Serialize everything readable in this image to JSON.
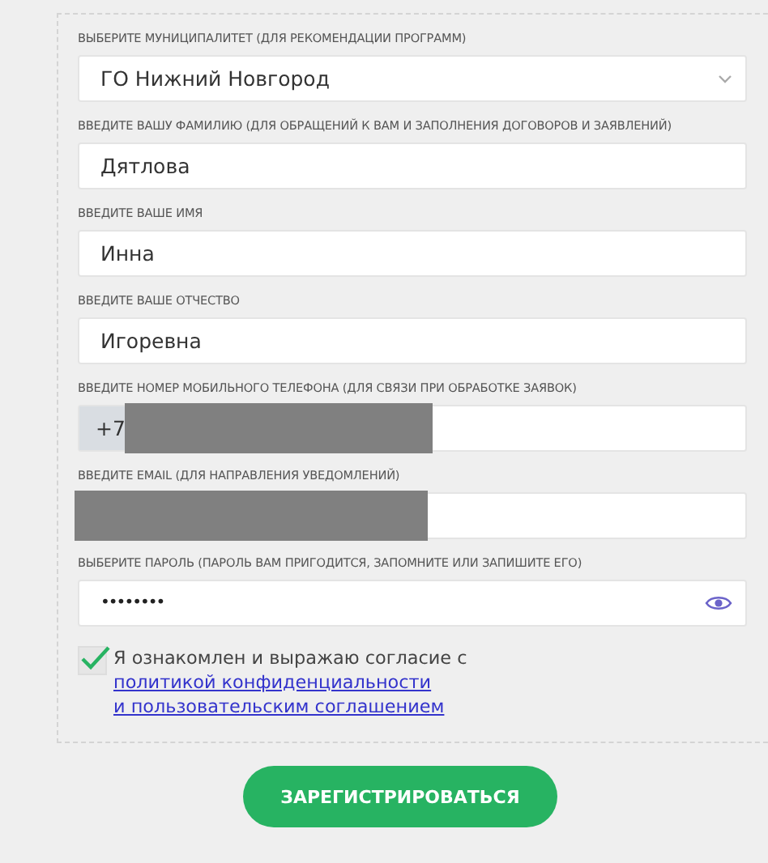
{
  "fields": [
    {
      "kind": "select",
      "label": "ВЫБЕРИТЕ МУНИЦИПАЛИТЕТ (ДЛЯ РЕКОМЕНДАЦИИ ПРОГРАММ)",
      "value": "ГО Нижний Новгород"
    },
    {
      "kind": "text",
      "label": "ВВЕДИТЕ ВАШУ ФАМИЛИЮ (ДЛЯ ОБРАЩЕНИЙ К ВАМ И ЗАПОЛНЕНИЯ ДОГОВОРОВ И ЗАЯВЛЕНИЙ)",
      "value": "Дятлова"
    },
    {
      "kind": "text",
      "label": "ВВЕДИТЕ ВАШЕ ИМЯ",
      "value": "Инна"
    },
    {
      "kind": "text",
      "label": "ВВЕДИТЕ ВАШЕ ОТЧЕСТВО",
      "value": "Игоревна"
    },
    {
      "kind": "phone",
      "label": "ВВЕДИТЕ НОМЕР МОБИЛЬНОГО ТЕЛЕФОНА (ДЛЯ СВЯЗИ ПРИ ОБРАБОТКЕ ЗАЯВОК)",
      "prefix": "+7",
      "redacted": true
    },
    {
      "kind": "text",
      "label": "ВВЕДИТЕ EMAIL (ДЛЯ НАПРАВЛЕНИЯ УВЕДОМЛЕНИЙ)",
      "redacted": true
    },
    {
      "kind": "password",
      "label": "ВЫБЕРИТЕ ПАРОЛЬ (ПАРОЛЬ ВАМ ПРИГОДИТСЯ, ЗАПОМНИТЕ ИЛИ ЗАПИШИТЕ ЕГО)",
      "value": "••••••••"
    }
  ],
  "consent": {
    "checked": true,
    "text": "Я ознакомлен и выражаю согласие с",
    "link_lines": [
      "политикой конфиденциальности",
      "и пользовательским соглашением"
    ]
  },
  "submit": "ЗАРЕГИСТРИРОВАТЬСЯ"
}
